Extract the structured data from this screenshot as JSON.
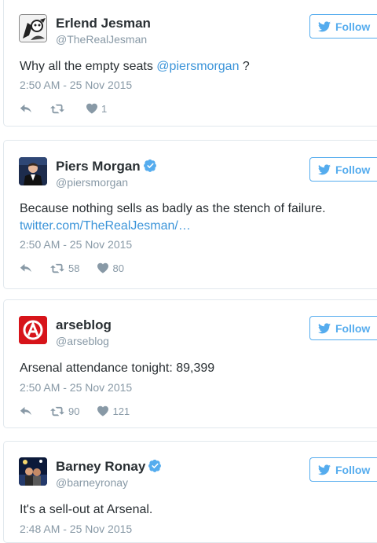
{
  "colors": {
    "accent": "#55acee",
    "link": "#3b94d9",
    "muted": "#8899a6",
    "text": "#292f33",
    "border": "#e1e8ed"
  },
  "tweets": [
    {
      "name": "Erlend Jesman",
      "handle": "@TheRealJesman",
      "verified": false,
      "follow_label": "Follow",
      "text_before": "Why all the empty seats ",
      "mention": "@piersmorgan",
      "text_after": " ?",
      "timestamp": "2:50 AM - 25 Nov 2015",
      "retweets": "",
      "likes": "1",
      "avatar_icon": "bw-cartoon-avatar"
    },
    {
      "name": "Piers Morgan",
      "handle": "@piersmorgan",
      "verified": true,
      "follow_label": "Follow",
      "text": "Because nothing sells as badly as the stench of failure.",
      "link": "twitter.com/TheRealJesman/…",
      "timestamp": "2:50 AM - 25 Nov 2015",
      "retweets": "58",
      "likes": "80",
      "avatar_icon": "suit-portrait-avatar"
    },
    {
      "name": "arseblog",
      "handle": "@arseblog",
      "verified": false,
      "follow_label": "Follow",
      "text": "Arsenal attendance tonight: 89,399",
      "timestamp": "2:50 AM - 25 Nov 2015",
      "retweets": "90",
      "likes": "121",
      "avatar_icon": "red-a-logo-avatar"
    },
    {
      "name": "Barney Ronay",
      "handle": "@barneyronay",
      "verified": true,
      "follow_label": "Follow",
      "text": "It's a sell-out at Arsenal.",
      "timestamp": "2:48 AM - 25 Nov 2015",
      "avatar_icon": "stage-photo-avatar"
    }
  ]
}
